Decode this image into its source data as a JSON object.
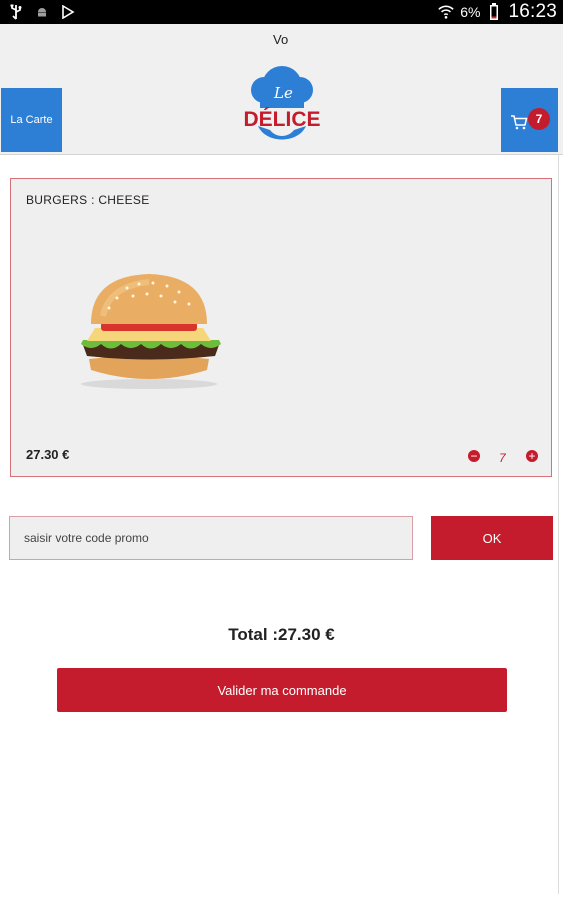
{
  "status_bar": {
    "battery_percent": "6%",
    "time": "16:23",
    "icons": [
      "usb-icon",
      "android-icon",
      "play-store-icon",
      "wifi-icon",
      "battery-icon"
    ]
  },
  "header": {
    "voice_text": "Vo",
    "carte_label": "La Carte",
    "cart_count": "7",
    "logo": {
      "script_text": "Le",
      "brand_text": "DÉLICE"
    }
  },
  "product": {
    "name": "BURGERS : CHEESE",
    "price": "27.30 €",
    "quantity": "7",
    "minus_symbol": "−",
    "plus_symbol": "+"
  },
  "promo": {
    "placeholder": "saisir votre code promo",
    "value": "",
    "ok_label": "OK"
  },
  "total_text": "Total :27.30 €",
  "validate_label": "Valider ma commande",
  "colors": {
    "accent_red": "#c41c2c",
    "header_blue": "#2d7fd6",
    "card_bg": "#efefef"
  }
}
